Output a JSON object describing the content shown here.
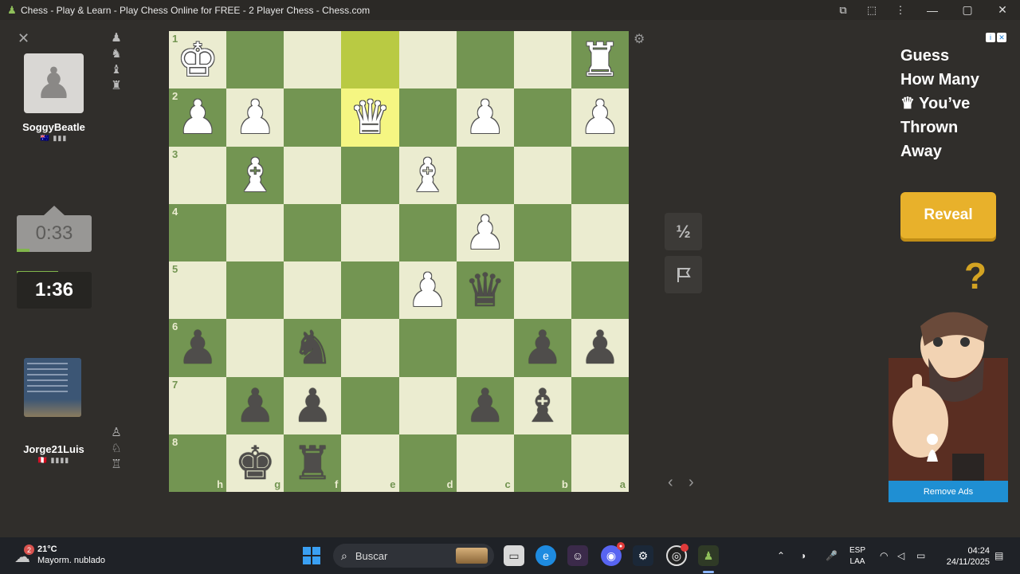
{
  "window": {
    "title": "Chess - Play & Learn - Play Chess Online for FREE - 2 Player Chess - Chess.com"
  },
  "opponent": {
    "name": "SoggyBeatle",
    "flag": "🇦🇺",
    "clock": "0:33",
    "captured": [
      "♟",
      "♞",
      "♝",
      "♜"
    ]
  },
  "me": {
    "name": "Jorge21Luis",
    "flag": "🇵🇪",
    "clock": "1:36",
    "captured": [
      "♙",
      "♘",
      "♖"
    ]
  },
  "board": {
    "orientation": "black",
    "ranks_labels": [
      "1",
      "2",
      "3",
      "4",
      "5",
      "6",
      "7",
      "8"
    ],
    "files_labels": [
      "h",
      "g",
      "f",
      "e",
      "d",
      "c",
      "b",
      "a"
    ],
    "rows": [
      [
        "wK",
        "",
        "",
        "",
        "",
        "",
        "",
        "wR"
      ],
      [
        "wP",
        "wP",
        "",
        "wQ",
        "",
        "wP",
        "",
        "wP"
      ],
      [
        "",
        "wB",
        "",
        "",
        "wB",
        "",
        "",
        ""
      ],
      [
        "",
        "",
        "",
        "",
        "",
        "wP",
        "",
        ""
      ],
      [
        "",
        "",
        "",
        "",
        "wP",
        "bQ",
        "",
        ""
      ],
      [
        "bP",
        "",
        "bN",
        "",
        "",
        "",
        "bP",
        "bP"
      ],
      [
        "",
        "bP",
        "bP",
        "",
        "",
        "bP",
        "bB",
        ""
      ],
      [
        "",
        "bK",
        "bR",
        "",
        "",
        "",
        "",
        ""
      ]
    ],
    "highlighted": [
      [
        0,
        3
      ],
      [
        1,
        3
      ]
    ]
  },
  "controls": {
    "draw_label": "½",
    "resign_icon": "flag-icon",
    "settings_icon": "gear-icon",
    "prev_icon": "chevron-left-icon",
    "next_icon": "chevron-right-icon"
  },
  "ad": {
    "headline": [
      "Guess",
      "How Many",
      "♛ You’ve",
      "Thrown",
      "Away"
    ],
    "button": "Reveal",
    "remove": "Remove Ads"
  },
  "taskbar": {
    "weather_temp": "21°C",
    "weather_desc": "Mayorm. nublado",
    "weather_badge": "2",
    "search_placeholder": "Buscar",
    "lang_top": "ESP",
    "lang_bottom": "LAA",
    "time": "04:24",
    "date": "24/11/2025"
  }
}
